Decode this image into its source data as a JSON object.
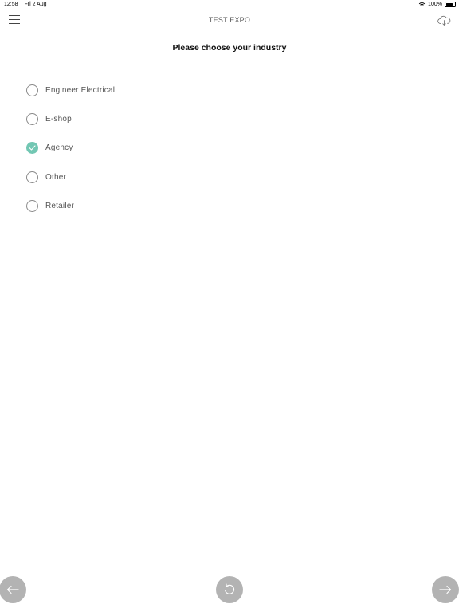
{
  "status_bar": {
    "time": "12:58",
    "date": "Fri 2 Aug",
    "battery": "100%",
    "battery_level": 1.0
  },
  "nav": {
    "title": "TEST EXPO",
    "menu_icon": "hamburger-menu-icon",
    "sync_icon": "cloud-sync-icon"
  },
  "question": {
    "title": "Please choose your industry",
    "options": [
      {
        "label": "Engineer Electrical",
        "selected": false
      },
      {
        "label": "E-shop",
        "selected": false
      },
      {
        "label": "Agency",
        "selected": true
      },
      {
        "label": "Other",
        "selected": false
      },
      {
        "label": "Retailer",
        "selected": false
      }
    ]
  },
  "footer": {
    "back_icon": "arrow-left-icon",
    "reset_icon": "refresh-icon",
    "next_icon": "arrow-right-icon"
  },
  "colors": {
    "accent": "#72c7b3",
    "button_bg": "#b3b3b3",
    "radio_border": "#8a8a8a"
  }
}
